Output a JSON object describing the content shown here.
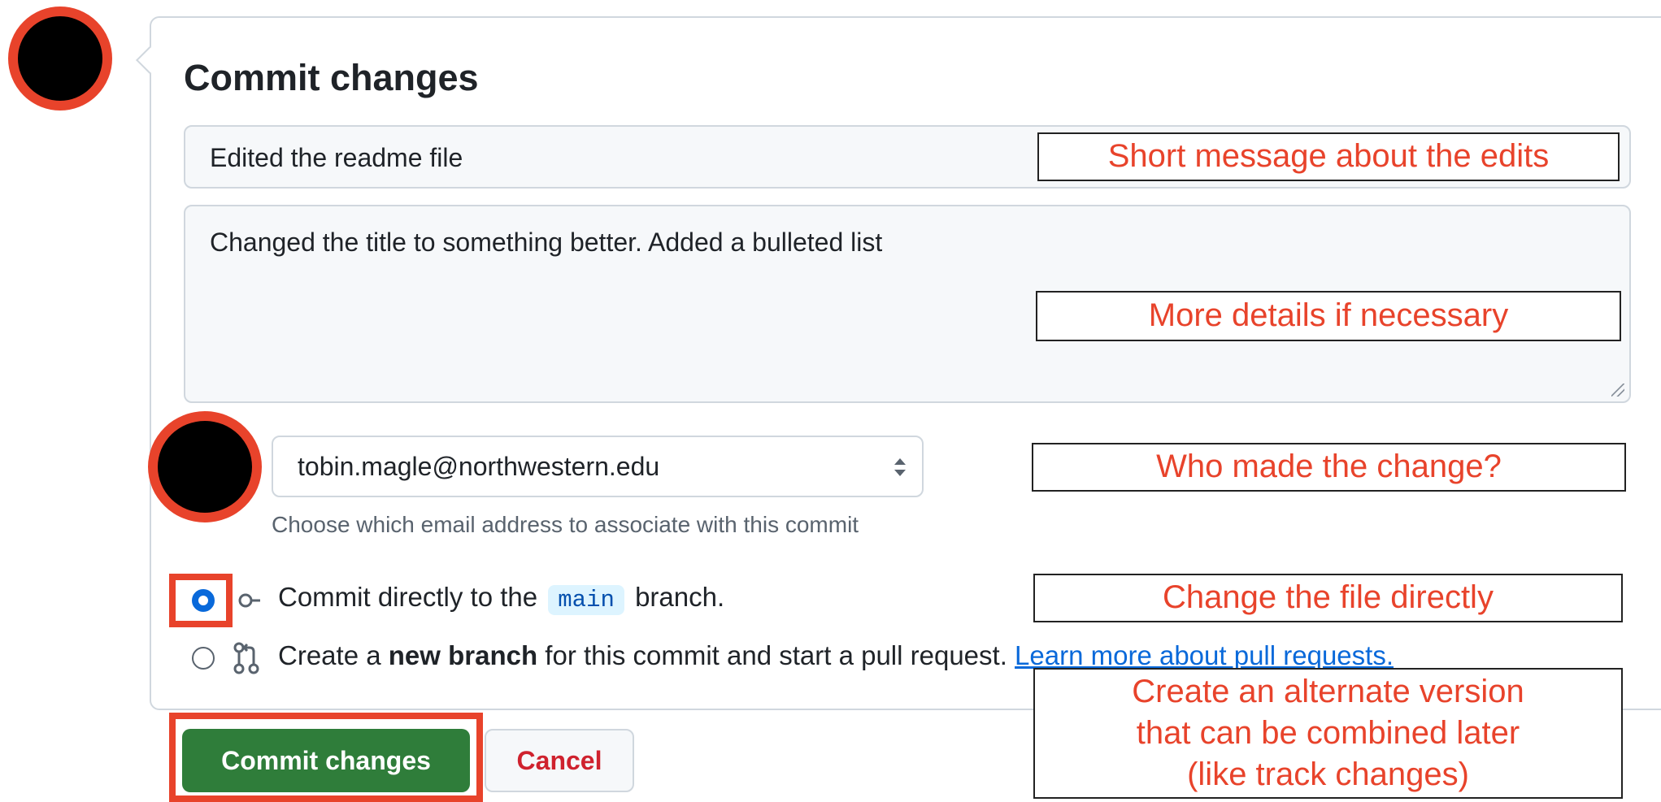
{
  "dialog": {
    "title": "Commit changes",
    "summary_value": "Edited the readme file",
    "description_value": "Changed the title to something better. Added a bulleted list",
    "email_value": "tobin.magle@northwestern.edu",
    "email_hint": "Choose which email address to associate with this commit",
    "option_direct": {
      "prefix": "Commit directly to the",
      "branch": "main",
      "suffix": "branch."
    },
    "option_new_branch": {
      "prefix": "Create a",
      "bold": "new branch",
      "suffix": "for this commit and start a pull request.",
      "link": "Learn more about pull requests."
    },
    "commit_button": "Commit changes",
    "cancel_button": "Cancel"
  },
  "annotations": {
    "summary": "Short message about the edits",
    "description": "More details if necessary",
    "author": "Who made the change?",
    "direct": "Change the file directly",
    "branch_line1": "Create an alternate version",
    "branch_line2": "that can be combined later",
    "branch_line3": "(like track changes)"
  },
  "colors": {
    "annotation_red": "#e8432b",
    "commit_green": "#2f7d3a",
    "cancel_red": "#cf222e",
    "link_blue": "#0969da"
  },
  "icons": {
    "direct_commit": "git-commit-icon",
    "new_branch": "git-pull-request-icon",
    "select": "chevron-up-down-icon"
  }
}
